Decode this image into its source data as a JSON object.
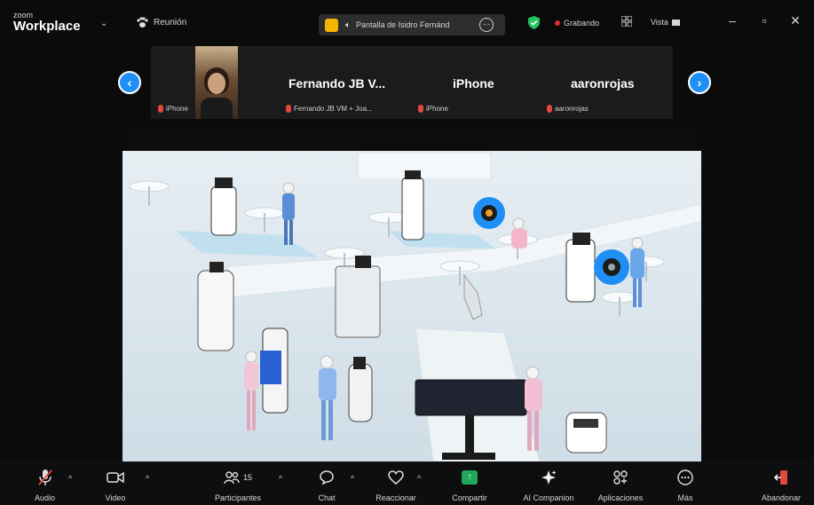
{
  "app": {
    "brand_small": "zoom",
    "brand_big": "Workplace"
  },
  "meeting": {
    "label": "Reunión"
  },
  "share": {
    "label": "Pantalla de Isidro Fernánd"
  },
  "recording": {
    "label": "Grabando"
  },
  "view": {
    "label": "Vista"
  },
  "colors": {
    "accent": "#1f8ff6",
    "record": "#e22b2b",
    "share_green": "#1fa85a",
    "leave_red": "#e2483b"
  },
  "participants_strip": {
    "video_label": "iPhone",
    "tiles": [
      {
        "name": "Fernando JB V...",
        "label": "Fernando JB VM + Joa..."
      },
      {
        "name": "iPhone",
        "label": "iPhone"
      },
      {
        "name": "aaronrojas",
        "label": "aaronrojas"
      }
    ]
  },
  "toolbar": {
    "audio": "Audio",
    "video": "Video",
    "participants": "Participantes",
    "participants_count": "15",
    "chat": "Chat",
    "react": "Reaccionar",
    "share": "Compartir",
    "ai": "AI Companion",
    "apps": "Aplicaciones",
    "more": "Más",
    "leave": "Abandonar"
  }
}
